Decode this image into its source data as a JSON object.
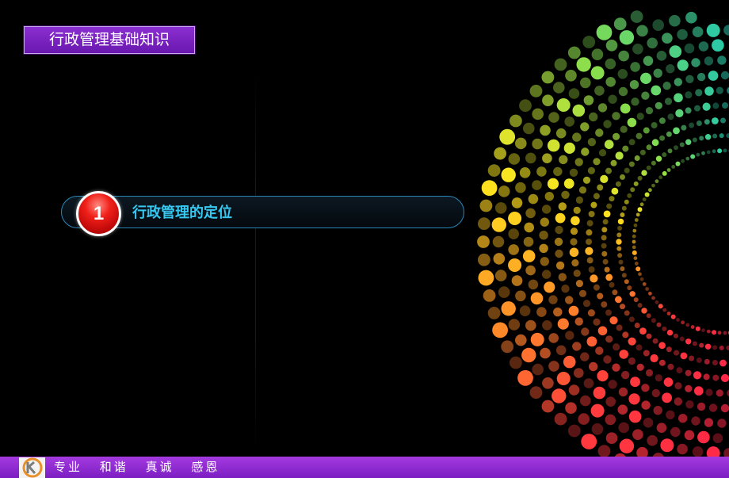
{
  "header": {
    "title": "行政管理基础知识"
  },
  "content": {
    "item": {
      "number": "1",
      "label": "行政管理的定位"
    }
  },
  "footer": {
    "logo_icon": "k-circle-logo-icon",
    "slogans": [
      "专业",
      "和谐",
      "真诚",
      "感恩"
    ]
  },
  "colors": {
    "title_bg": "#7a22c2",
    "pill_border": "#2a86b6",
    "label_text": "#36c8f0",
    "number_circle": "#e0140f",
    "footer_bg": "#8e2ad0",
    "background": "#000000"
  }
}
